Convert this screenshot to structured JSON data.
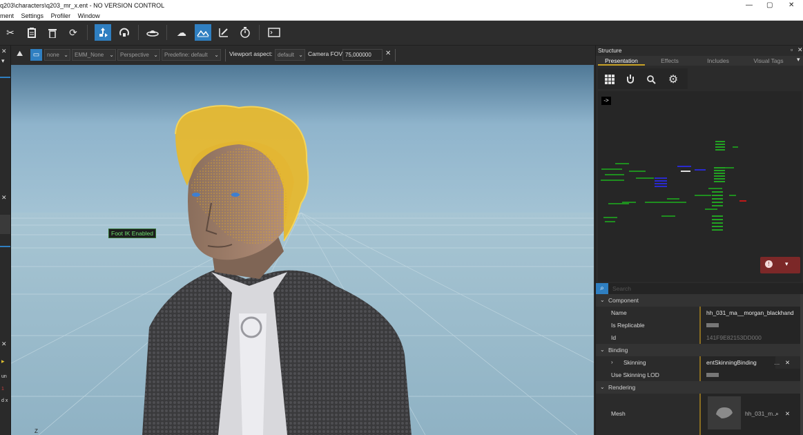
{
  "window": {
    "title": "q203\\characters\\q203_mr_x.ent  - NO VERSION CONTROL",
    "controls": [
      "—",
      "▢",
      "✕"
    ]
  },
  "menu": [
    "ment",
    "Settings",
    "Profiler",
    "Window"
  ],
  "viewport_toolbar": {
    "none": "none",
    "emm": "EMM_None",
    "camera": "Perspective",
    "predefine": "Predefine: default",
    "aspect_label": "Viewport aspect:",
    "aspect_value": "default",
    "fov_label": "Camera FOV:",
    "fov_value": "75,000000"
  },
  "viewport": {
    "overlay": "Foot IK Enabled"
  },
  "left_strip": {
    "frag1": "un",
    "frag2": "1",
    "frag3": "d x"
  },
  "panel": {
    "title": "Structure",
    "tabs": [
      "Presentation",
      "Effects",
      "Includes",
      "Visual Tags"
    ],
    "arrow": "->",
    "search_placeholder": "Search"
  },
  "properties": {
    "component": "Component",
    "name_label": "Name",
    "name_value": "hh_031_ma__morgan_blackhand",
    "replicable_label": "Is Replicable",
    "id_label": "Id",
    "id_value": "141F9E82153DD000",
    "binding": "Binding",
    "skinning_label": "Skinning",
    "skinning_value": "entSkinningBinding",
    "use_lod_label": "Use Skinning LOD",
    "rendering": "Rendering",
    "mesh_label": "Mesh",
    "mesh_value": "hh_031_m.."
  },
  "colors": {
    "accent": "#2f7fc1",
    "highlight": "#c9a326",
    "sky": "#8fb4cc"
  }
}
